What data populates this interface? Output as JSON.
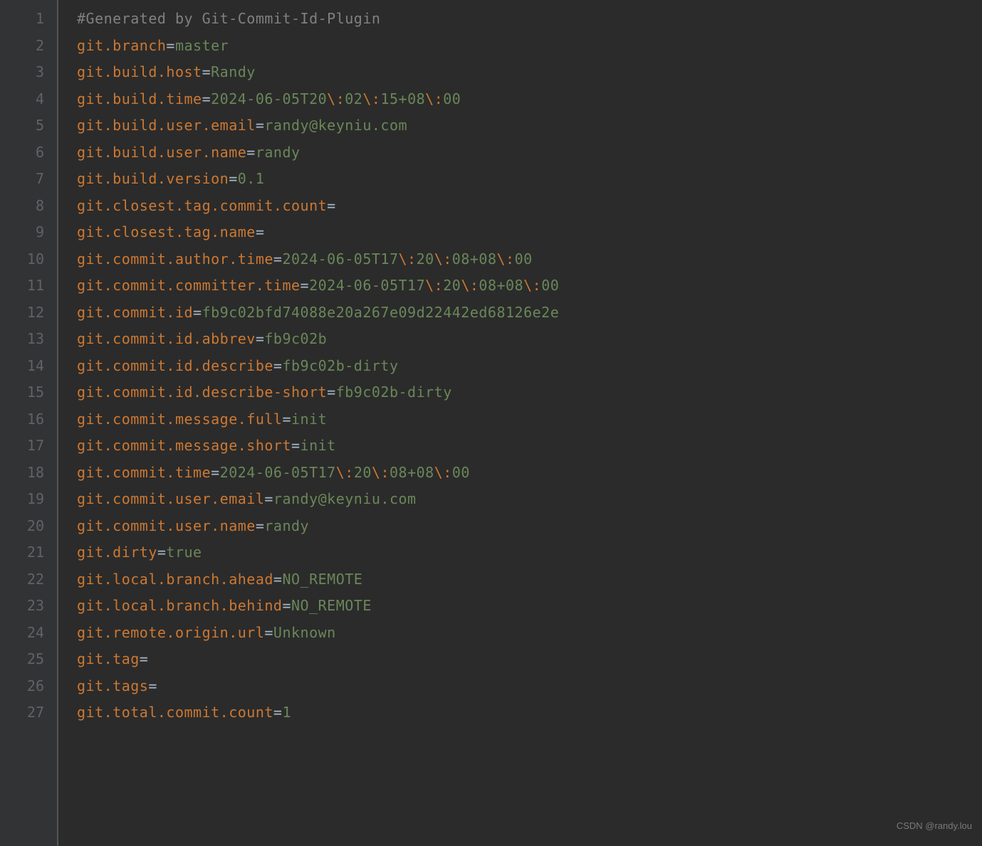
{
  "watermark": "CSDN @randy.lou",
  "lines": [
    {
      "num": "1",
      "segments": [
        {
          "text": "#Generated by Git-Commit-Id-Plugin",
          "cls": "comment"
        }
      ]
    },
    {
      "num": "2",
      "segments": [
        {
          "text": "git.branch",
          "cls": "key"
        },
        {
          "text": "=",
          "cls": ""
        },
        {
          "text": "master",
          "cls": "value"
        }
      ]
    },
    {
      "num": "3",
      "segments": [
        {
          "text": "git.build.host",
          "cls": "key"
        },
        {
          "text": "=",
          "cls": ""
        },
        {
          "text": "Randy",
          "cls": "value"
        }
      ]
    },
    {
      "num": "4",
      "segments": [
        {
          "text": "git.build.time",
          "cls": "key"
        },
        {
          "text": "=",
          "cls": ""
        },
        {
          "text": "2024-06-05T20",
          "cls": "value"
        },
        {
          "text": "\\:",
          "cls": "escape"
        },
        {
          "text": "02",
          "cls": "value"
        },
        {
          "text": "\\:",
          "cls": "escape"
        },
        {
          "text": "15+08",
          "cls": "value"
        },
        {
          "text": "\\:",
          "cls": "escape"
        },
        {
          "text": "00",
          "cls": "value"
        }
      ]
    },
    {
      "num": "5",
      "segments": [
        {
          "text": "git.build.user.email",
          "cls": "key"
        },
        {
          "text": "=",
          "cls": ""
        },
        {
          "text": "randy@keyniu.com",
          "cls": "value"
        }
      ]
    },
    {
      "num": "6",
      "segments": [
        {
          "text": "git.build.user.name",
          "cls": "key"
        },
        {
          "text": "=",
          "cls": ""
        },
        {
          "text": "randy",
          "cls": "value"
        }
      ]
    },
    {
      "num": "7",
      "segments": [
        {
          "text": "git.build.version",
          "cls": "key"
        },
        {
          "text": "=",
          "cls": ""
        },
        {
          "text": "0.1",
          "cls": "value"
        }
      ]
    },
    {
      "num": "8",
      "segments": [
        {
          "text": "git.closest.tag.commit.count",
          "cls": "key"
        },
        {
          "text": "=",
          "cls": ""
        }
      ]
    },
    {
      "num": "9",
      "segments": [
        {
          "text": "git.closest.tag.name",
          "cls": "key"
        },
        {
          "text": "=",
          "cls": ""
        }
      ]
    },
    {
      "num": "10",
      "segments": [
        {
          "text": "git.commit.author.time",
          "cls": "key"
        },
        {
          "text": "=",
          "cls": ""
        },
        {
          "text": "2024-06-05T17",
          "cls": "value"
        },
        {
          "text": "\\:",
          "cls": "escape"
        },
        {
          "text": "20",
          "cls": "value"
        },
        {
          "text": "\\:",
          "cls": "escape"
        },
        {
          "text": "08+08",
          "cls": "value"
        },
        {
          "text": "\\:",
          "cls": "escape"
        },
        {
          "text": "00",
          "cls": "value"
        }
      ]
    },
    {
      "num": "11",
      "segments": [
        {
          "text": "git.commit.committer.time",
          "cls": "key"
        },
        {
          "text": "=",
          "cls": ""
        },
        {
          "text": "2024-06-05T17",
          "cls": "value"
        },
        {
          "text": "\\:",
          "cls": "escape"
        },
        {
          "text": "20",
          "cls": "value"
        },
        {
          "text": "\\:",
          "cls": "escape"
        },
        {
          "text": "08+08",
          "cls": "value"
        },
        {
          "text": "\\:",
          "cls": "escape"
        },
        {
          "text": "00",
          "cls": "value"
        }
      ]
    },
    {
      "num": "12",
      "segments": [
        {
          "text": "git.commit.id",
          "cls": "key"
        },
        {
          "text": "=",
          "cls": ""
        },
        {
          "text": "fb9c02bfd74088e20a267e09d22442ed68126e2e",
          "cls": "value"
        }
      ]
    },
    {
      "num": "13",
      "segments": [
        {
          "text": "git.commit.id.abbrev",
          "cls": "key"
        },
        {
          "text": "=",
          "cls": ""
        },
        {
          "text": "fb9c02b",
          "cls": "value"
        }
      ]
    },
    {
      "num": "14",
      "segments": [
        {
          "text": "git.commit.id.describe",
          "cls": "key"
        },
        {
          "text": "=",
          "cls": ""
        },
        {
          "text": "fb9c02b-dirty",
          "cls": "value"
        }
      ]
    },
    {
      "num": "15",
      "segments": [
        {
          "text": "git.commit.id.describe-short",
          "cls": "key"
        },
        {
          "text": "=",
          "cls": ""
        },
        {
          "text": "fb9c02b-dirty",
          "cls": "value"
        }
      ]
    },
    {
      "num": "16",
      "segments": [
        {
          "text": "git.commit.message.full",
          "cls": "key"
        },
        {
          "text": "=",
          "cls": ""
        },
        {
          "text": "init",
          "cls": "value"
        }
      ]
    },
    {
      "num": "17",
      "segments": [
        {
          "text": "git.commit.message.short",
          "cls": "key"
        },
        {
          "text": "=",
          "cls": ""
        },
        {
          "text": "init",
          "cls": "value"
        }
      ]
    },
    {
      "num": "18",
      "segments": [
        {
          "text": "git.commit.time",
          "cls": "key"
        },
        {
          "text": "=",
          "cls": ""
        },
        {
          "text": "2024-06-05T17",
          "cls": "value"
        },
        {
          "text": "\\:",
          "cls": "escape"
        },
        {
          "text": "20",
          "cls": "value"
        },
        {
          "text": "\\:",
          "cls": "escape"
        },
        {
          "text": "08+08",
          "cls": "value"
        },
        {
          "text": "\\:",
          "cls": "escape"
        },
        {
          "text": "00",
          "cls": "value"
        }
      ]
    },
    {
      "num": "19",
      "segments": [
        {
          "text": "git.commit.user.email",
          "cls": "key"
        },
        {
          "text": "=",
          "cls": ""
        },
        {
          "text": "randy@keyniu.com",
          "cls": "value"
        }
      ]
    },
    {
      "num": "20",
      "segments": [
        {
          "text": "git.commit.user.name",
          "cls": "key"
        },
        {
          "text": "=",
          "cls": ""
        },
        {
          "text": "randy",
          "cls": "value"
        }
      ]
    },
    {
      "num": "21",
      "segments": [
        {
          "text": "git.dirty",
          "cls": "key"
        },
        {
          "text": "=",
          "cls": ""
        },
        {
          "text": "true",
          "cls": "value"
        }
      ]
    },
    {
      "num": "22",
      "segments": [
        {
          "text": "git.local.branch.ahead",
          "cls": "key"
        },
        {
          "text": "=",
          "cls": ""
        },
        {
          "text": "NO_REMOTE",
          "cls": "value"
        }
      ]
    },
    {
      "num": "23",
      "segments": [
        {
          "text": "git.local.branch.behind",
          "cls": "key"
        },
        {
          "text": "=",
          "cls": ""
        },
        {
          "text": "NO_REMOTE",
          "cls": "value"
        }
      ]
    },
    {
      "num": "24",
      "segments": [
        {
          "text": "git.remote.origin.url",
          "cls": "key"
        },
        {
          "text": "=",
          "cls": ""
        },
        {
          "text": "Unknown",
          "cls": "value"
        }
      ]
    },
    {
      "num": "25",
      "segments": [
        {
          "text": "git.tag",
          "cls": "key"
        },
        {
          "text": "=",
          "cls": ""
        }
      ]
    },
    {
      "num": "26",
      "segments": [
        {
          "text": "git.tags",
          "cls": "key"
        },
        {
          "text": "=",
          "cls": ""
        }
      ]
    },
    {
      "num": "27",
      "segments": [
        {
          "text": "git.total.commit.count",
          "cls": "key"
        },
        {
          "text": "=",
          "cls": ""
        },
        {
          "text": "1",
          "cls": "value"
        }
      ]
    }
  ]
}
